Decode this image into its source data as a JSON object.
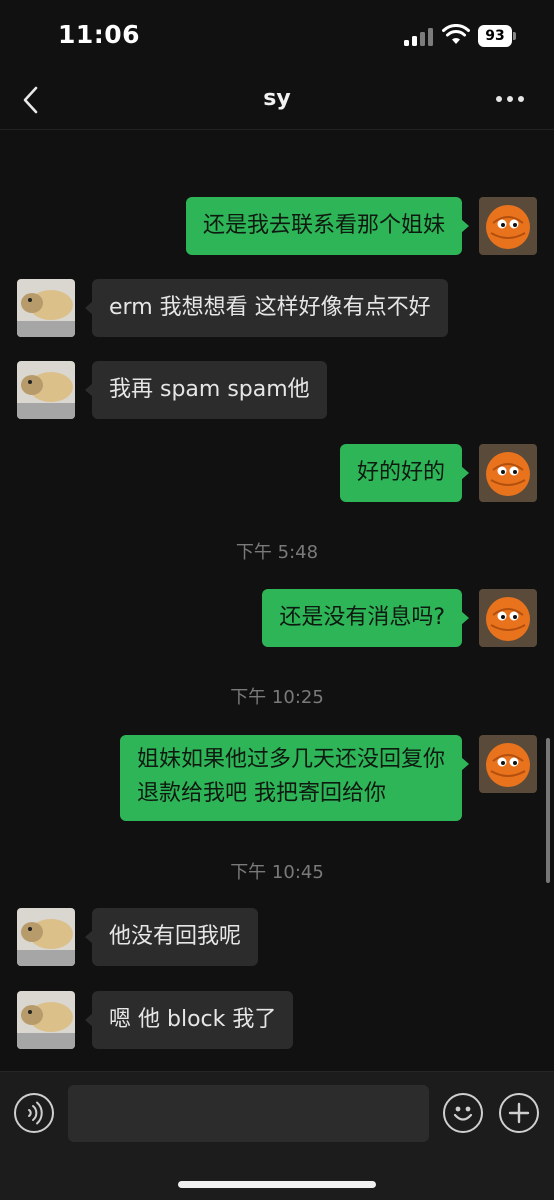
{
  "status_bar": {
    "time": "11:06",
    "battery": "93"
  },
  "nav": {
    "title": "sy"
  },
  "messages": [
    {
      "side": "right",
      "text": "还是我去联系看那个姐妹"
    },
    {
      "side": "left",
      "text": "erm 我想想看 这样好像有点不好"
    },
    {
      "side": "left",
      "text": "我再 spam spam他"
    },
    {
      "side": "right",
      "text": "好的好的"
    },
    {
      "type": "timestamp",
      "text": "下午 5:48"
    },
    {
      "side": "right",
      "text": "还是没有消息吗?"
    },
    {
      "type": "timestamp",
      "text": "下午 10:25"
    },
    {
      "side": "right",
      "lines": [
        "姐妹如果他过多几天还没回复你",
        "退款给我吧 我把寄回给你"
      ]
    },
    {
      "type": "timestamp",
      "text": "下午 10:45"
    },
    {
      "side": "left",
      "text": "他没有回我呢"
    },
    {
      "side": "left",
      "text": "嗯 他 block 我了"
    }
  ],
  "input": {
    "value": "",
    "placeholder": ""
  },
  "icons": {
    "back": "chevron-left-icon",
    "more": "more-dots-icon",
    "voice": "voice-icon",
    "emoji": "emoji-icon",
    "plus": "plus-icon"
  },
  "colors": {
    "background": "#111111",
    "bubble_self": "#2db558",
    "bubble_other": "#2c2c2c",
    "input_bar": "#1c1c1c"
  }
}
